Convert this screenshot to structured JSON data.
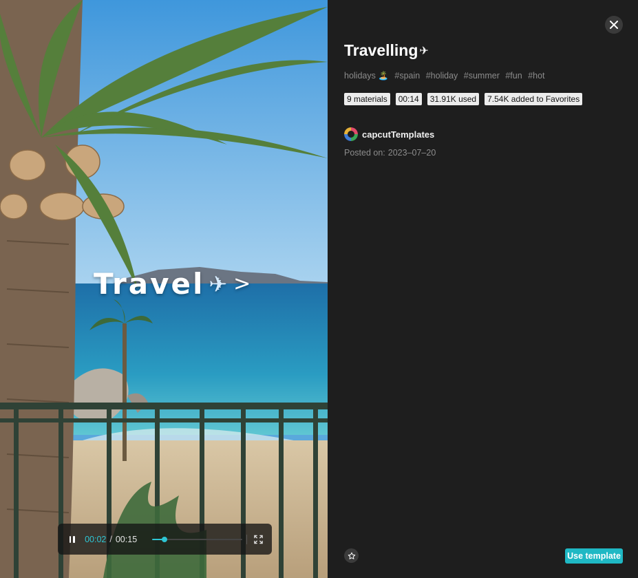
{
  "video": {
    "overlay_text": "Travel",
    "overlay_icon": "airplane",
    "overlay_arrow": ">",
    "player": {
      "current_time": "00:02",
      "separator": "/",
      "total_time": "00:15",
      "progress_fraction": 0.133
    }
  },
  "details": {
    "title": "Travelling",
    "title_icon": "✈",
    "hashtags": [
      "holidays 🏝️",
      "#spain",
      "#holiday",
      "#summer",
      "#fun",
      "#hot"
    ],
    "tags": [
      "9 materials",
      "00:14",
      "31.91K used",
      "7.54K added to Favorites"
    ],
    "author": {
      "name": "capcutTemplates",
      "avatar_icon": "avatar"
    },
    "posted_label": "Posted on:",
    "posted_date": "2023–07–20",
    "use_template_label": "Use template",
    "favorite_icon": "star-icon",
    "close_icon": "close-icon"
  },
  "colors": {
    "accent": "#1fb8c4",
    "panel_bg": "#1e1e1e",
    "muted_text": "#8c8c8c",
    "tag_bg": "#ececec"
  }
}
